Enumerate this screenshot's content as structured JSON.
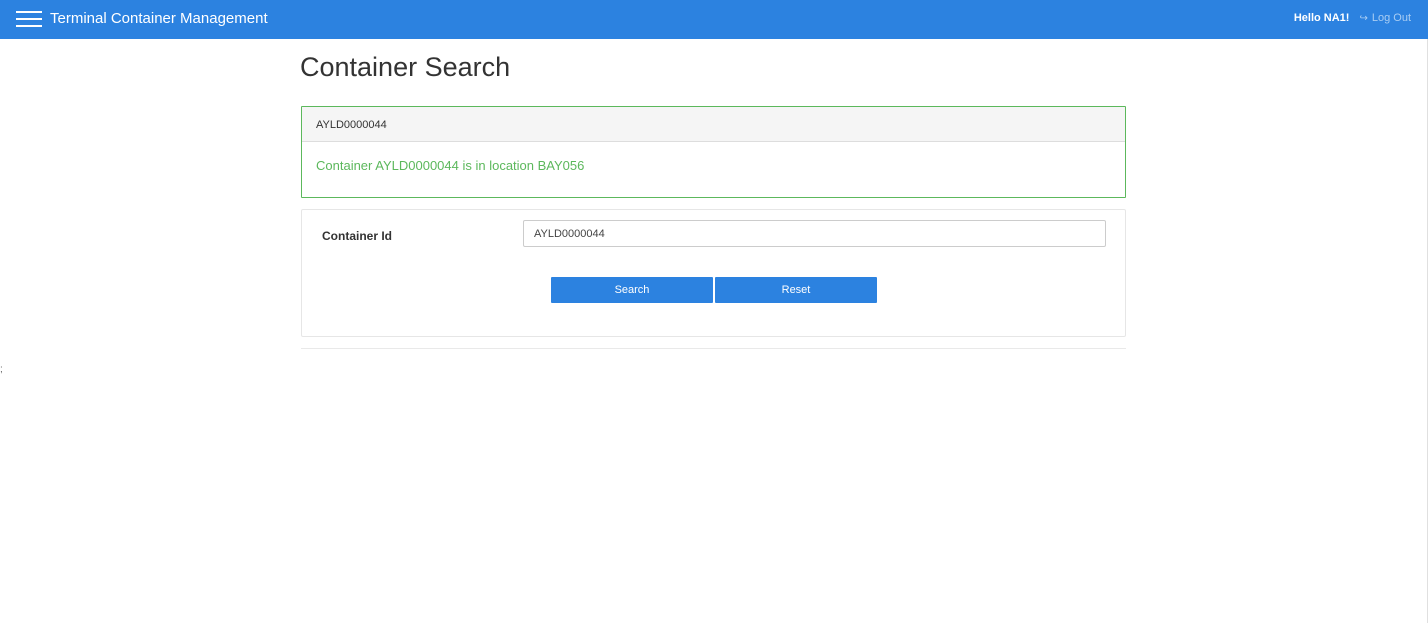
{
  "header": {
    "brand": "Terminal Container Management",
    "greeting": "Hello NA1!",
    "logout_label": "Log Out",
    "logout_icon": "sign-out-icon",
    "menu_icon": "hamburger-menu-icon"
  },
  "page": {
    "title": "Container Search",
    "stray_char": ";"
  },
  "result": {
    "heading": "AYLD0000044",
    "message": "Container AYLD0000044 is in location BAY056"
  },
  "form": {
    "container_id_label": "Container Id",
    "container_id_value": "AYLD0000044",
    "search_label": "Search",
    "reset_label": "Reset"
  },
  "colors": {
    "primary": "#2c82e0",
    "success": "#5cb85c"
  }
}
